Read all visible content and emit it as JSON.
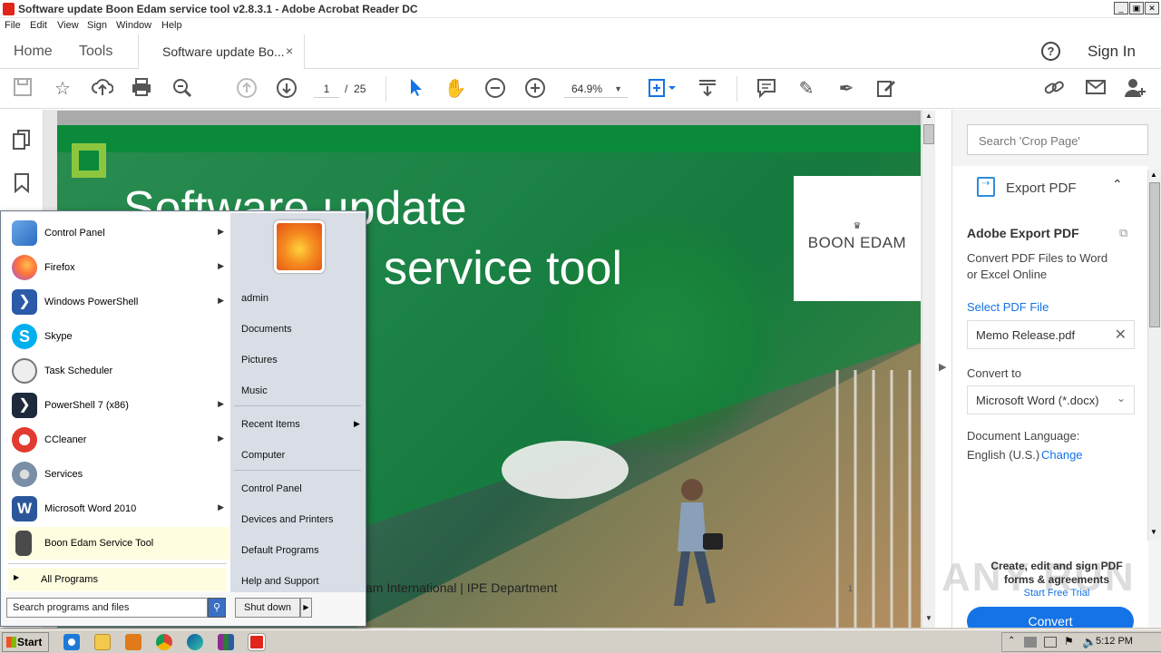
{
  "window": {
    "title": "Software update Boon Edam service tool v2.8.3.1 - Adobe Acrobat Reader DC",
    "min": "_",
    "max": "▣",
    "close": "✕"
  },
  "menu": [
    "File",
    "Edit",
    "View",
    "Sign",
    "Window",
    "Help"
  ],
  "tabs": {
    "home": "Home",
    "tools": "Tools",
    "doc": "Software update Bo...",
    "doc_close": "×"
  },
  "header": {
    "help": "?",
    "signin": "Sign In"
  },
  "toolbar": {
    "page_current": "1",
    "page_sep": "/",
    "page_total": "25",
    "zoom": "64.9%"
  },
  "document": {
    "heading_line1": "Software update",
    "heading_line2": "service tool",
    "brand": "BOON EDAM",
    "brand_crown": "♛",
    "footer": "am International    |   IPE Department",
    "page_number": "1"
  },
  "right_panel": {
    "search_placeholder": "Search 'Crop Page'",
    "export_header": "Export PDF",
    "title": "Adobe Export PDF",
    "desc_line1": "Convert PDF Files to Word",
    "desc_line2": "or Excel Online",
    "select_label": "Select PDF File",
    "file_name": "Memo Release.pdf",
    "convert_to_label": "Convert to",
    "format": "Microsoft Word (*.docx)",
    "lang_label": "Document Language:",
    "lang_value": "English (U.S.)",
    "lang_change": "Change",
    "convert_button": "Convert",
    "promo_line1": "Create, edit and sign PDF",
    "promo_line2": "forms & agreements",
    "promo_link": "Start Free Trial"
  },
  "watermark": "ANY RUN",
  "start_menu": {
    "left_items": [
      {
        "label": "Control Panel",
        "icon": "control-panel-icon",
        "arrow": true
      },
      {
        "label": "Firefox",
        "icon": "firefox-icon",
        "arrow": true
      },
      {
        "label": "Windows PowerShell",
        "icon": "powershell-icon",
        "arrow": true
      },
      {
        "label": "Skype",
        "icon": "skype-icon",
        "arrow": false
      },
      {
        "label": "Task Scheduler",
        "icon": "task-scheduler-icon",
        "arrow": false
      },
      {
        "label": "PowerShell 7 (x86)",
        "icon": "powershell7-icon",
        "arrow": true
      },
      {
        "label": "CCleaner",
        "icon": "ccleaner-icon",
        "arrow": true
      },
      {
        "label": "Services",
        "icon": "services-icon",
        "arrow": false
      },
      {
        "label": "Microsoft Word 2010",
        "icon": "word-icon",
        "arrow": true
      },
      {
        "label": "Boon Edam Service Tool",
        "icon": "boon-edam-tool-icon",
        "arrow": false
      }
    ],
    "all_programs": "All Programs",
    "search_placeholder": "Search programs and files",
    "right_items": [
      "admin",
      "Documents",
      "Pictures",
      "Music",
      "Recent Items",
      "Computer",
      "Control Panel",
      "Devices and Printers",
      "Default Programs",
      "Help and Support"
    ],
    "shutdown": "Shut down"
  },
  "taskbar": {
    "start": "Start",
    "clock": "5:12 PM"
  }
}
